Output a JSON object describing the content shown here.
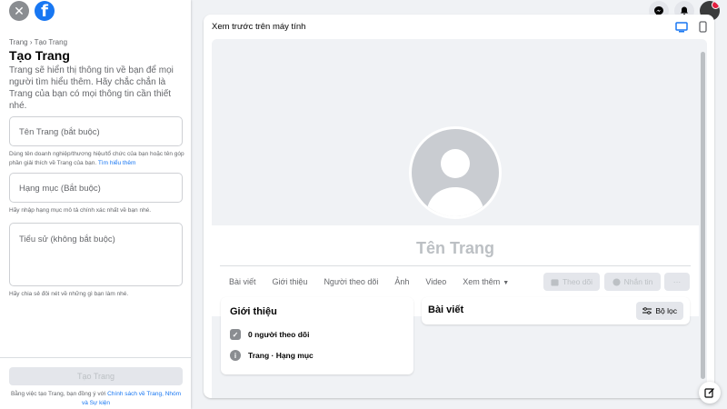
{
  "left_panel": {
    "breadcrumb": "Trang › Tạo Trang",
    "title": "Tạo Trang",
    "description": "Trang sẽ hiển thị thông tin về bạn để mọi người tìm hiểu thêm. Hãy chắc chắn là Trang của bạn có mọi thông tin cần thiết nhé.",
    "name_field": {
      "placeholder": "Tên Trang (bắt buộc)",
      "help": "Dùng tên doanh nghiệp/thương hiệu/tổ chức của bạn hoặc tên góp phần giải thích về Trang của bạn.",
      "help_link": "Tìm hiểu thêm"
    },
    "category_field": {
      "placeholder": "Hạng mục (Bắt buộc)",
      "help": "Hãy nhập hạng mục mô tả chính xác nhất về bạn nhé."
    },
    "bio_field": {
      "placeholder": "Tiểu sử (không bắt buộc)",
      "help": "Hãy chia sẻ đôi nét về những gì bạn làm nhé."
    },
    "create_button": "Tạo Trang",
    "terms_prefix": "Bằng việc tạo Trang, bạn đồng ý với ",
    "terms_link": "Chính sách về Trang, Nhóm và Sự kiện"
  },
  "preview": {
    "header": "Xem trước trên máy tính",
    "page_name": "Tên Trang",
    "tabs": [
      "Bài viết",
      "Giới thiệu",
      "Người theo dõi",
      "Ảnh",
      "Video",
      "Xem thêm"
    ],
    "follow_button": "Theo dõi",
    "message_button": "Nhắn tin",
    "more_button": "···",
    "about_card": {
      "title": "Giới thiệu",
      "followers": "0 người theo dõi",
      "page_type": "Trang · Hạng mục"
    },
    "posts_card": {
      "title": "Bài viết",
      "filter_button": "Bộ lọc"
    }
  },
  "icons": {
    "close": "close-icon",
    "facebook": "facebook-logo-icon",
    "messenger": "messenger-icon",
    "notifications": "bell-icon",
    "desktop": "desktop-icon",
    "mobile": "mobile-icon",
    "edit": "compose-icon"
  },
  "colors": {
    "brand_blue": "#1877f2",
    "background": "#f0f2f5",
    "disabled_text": "#bcc0c4"
  }
}
